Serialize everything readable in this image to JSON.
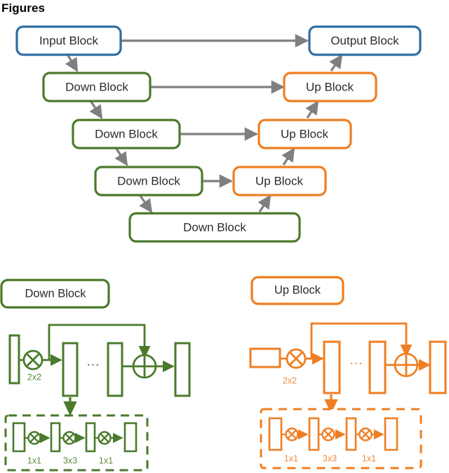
{
  "page": {
    "heading": "Figures",
    "background": "#ffffff"
  },
  "colors": {
    "input_output_blue": "#2E6DA4",
    "down_green": "#4A7A2B",
    "up_orange": "#EF7E22",
    "arrow_gray": "#7F7F7F",
    "text_dark": "#2B2B2B",
    "label_green": "#5D8A3C",
    "label_orange": "#EF8C42"
  },
  "unet_diagram": {
    "name": "u-net-architecture",
    "nodes": [
      {
        "id": "input",
        "label": "Input Block",
        "kind": "input",
        "color": "#2E6DA4"
      },
      {
        "id": "output",
        "label": "Output Block",
        "kind": "output",
        "color": "#2E6DA4"
      },
      {
        "id": "down1",
        "label": "Down Block",
        "kind": "down",
        "color": "#4A7A2B"
      },
      {
        "id": "down2",
        "label": "Down Block",
        "kind": "down",
        "color": "#4A7A2B"
      },
      {
        "id": "down3",
        "label": "Down Block",
        "kind": "down",
        "color": "#4A7A2B"
      },
      {
        "id": "down4",
        "label": "Down Block",
        "kind": "down",
        "color": "#4A7A2B"
      },
      {
        "id": "up1",
        "label": "Up Block",
        "kind": "up",
        "color": "#EF7E22"
      },
      {
        "id": "up2",
        "label": "Up Block",
        "kind": "up",
        "color": "#EF7E22"
      },
      {
        "id": "up3",
        "label": "Up Block",
        "kind": "up",
        "color": "#EF7E22"
      }
    ],
    "edges": [
      {
        "from": "input",
        "to": "output",
        "type": "skip"
      },
      {
        "from": "input",
        "to": "down1",
        "type": "down"
      },
      {
        "from": "down1",
        "to": "up1",
        "type": "skip"
      },
      {
        "from": "down1",
        "to": "down2",
        "type": "down"
      },
      {
        "from": "down2",
        "to": "up2",
        "type": "skip"
      },
      {
        "from": "down2",
        "to": "down3",
        "type": "down"
      },
      {
        "from": "down3",
        "to": "up3",
        "type": "skip"
      },
      {
        "from": "down3",
        "to": "down4",
        "type": "down"
      },
      {
        "from": "down4",
        "to": "up3",
        "type": "up"
      },
      {
        "from": "up3",
        "to": "up2",
        "type": "up"
      },
      {
        "from": "up2",
        "to": "up1",
        "type": "up"
      },
      {
        "from": "up1",
        "to": "output",
        "type": "up"
      }
    ]
  },
  "down_block_detail": {
    "title": "Down Block",
    "color": "#4A7A2B",
    "conv_label": "2x2",
    "ellipsis": "...",
    "residual_ops": [
      "1x1",
      "3x3",
      "1x1"
    ],
    "sum_symbol": "+",
    "mul_symbol": "x"
  },
  "up_block_detail": {
    "title": "Up Block",
    "color": "#EF7E22",
    "conv_label": "2x2",
    "ellipsis": "...",
    "residual_ops": [
      "1x1",
      "3x3",
      "1x1"
    ],
    "sum_symbol": "+",
    "mul_symbol": "x"
  }
}
